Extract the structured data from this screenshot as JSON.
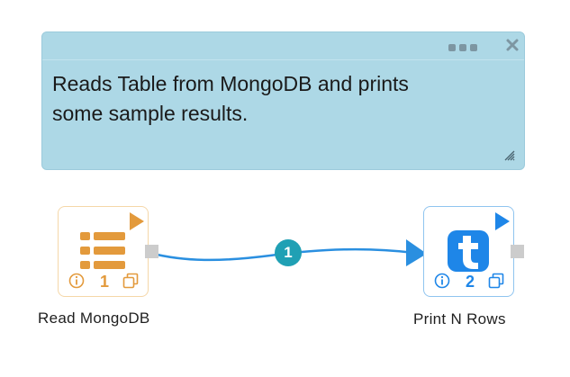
{
  "note": {
    "text": "Reads Table from MongoDB and prints\nsome sample results."
  },
  "connector": {
    "label": "1",
    "color": "#2a8fe0",
    "badge_color": "#20a0b4"
  },
  "nodes": [
    {
      "id": "read",
      "label": "Read MongoDB",
      "number": "1",
      "accent": "#e39a3c",
      "icon": "table-list-icon"
    },
    {
      "id": "print",
      "label": "Print N Rows",
      "number": "2",
      "accent": "#1e86e8",
      "icon": "letter-t-icon"
    }
  ],
  "colors": {
    "note_bg": "#add8e6",
    "port": "#cccccc"
  }
}
